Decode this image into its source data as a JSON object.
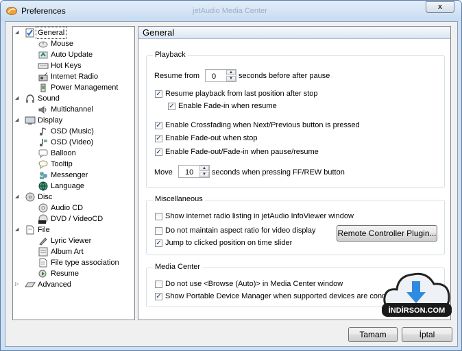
{
  "window": {
    "title": "Preferences",
    "ghost_title": "jetAudio Media Center",
    "close_label": "x"
  },
  "tree": {
    "items": [
      {
        "label": "General",
        "icon": "checklist-icon",
        "level": 0,
        "expander": "expanded",
        "selected": true
      },
      {
        "label": "Mouse",
        "icon": "mouse-icon",
        "level": 1
      },
      {
        "label": "Auto Update",
        "icon": "update-icon",
        "level": 1
      },
      {
        "label": "Hot Keys",
        "icon": "keyboard-icon",
        "level": 1
      },
      {
        "label": "Internet Radio",
        "icon": "radio-icon",
        "level": 1
      },
      {
        "label": "Power Management",
        "icon": "power-icon",
        "level": 1
      },
      {
        "label": "Sound",
        "icon": "headphones-icon",
        "level": 0,
        "expander": "expanded"
      },
      {
        "label": "Multichannel",
        "icon": "speaker-icon",
        "level": 1
      },
      {
        "label": "Display",
        "icon": "monitor-icon",
        "level": 0,
        "expander": "expanded"
      },
      {
        "label": "OSD (Music)",
        "icon": "music-note-icon",
        "level": 1
      },
      {
        "label": "OSD (Video)",
        "icon": "video-note-icon",
        "level": 1
      },
      {
        "label": "Balloon",
        "icon": "balloon-icon",
        "level": 1
      },
      {
        "label": "Tooltip",
        "icon": "tooltip-icon",
        "level": 1
      },
      {
        "label": "Messenger",
        "icon": "messenger-icon",
        "level": 1
      },
      {
        "label": "Language",
        "icon": "globe-icon",
        "level": 1
      },
      {
        "label": "Disc",
        "icon": "disc-icon",
        "level": 0,
        "expander": "expanded"
      },
      {
        "label": "Audio CD",
        "icon": "cd-icon",
        "level": 1
      },
      {
        "label": "DVD / VideoCD",
        "icon": "dvd-icon",
        "level": 1
      },
      {
        "label": "File",
        "icon": "file-icon",
        "level": 0,
        "expander": "expanded"
      },
      {
        "label": "Lyric Viewer",
        "icon": "pen-icon",
        "level": 1
      },
      {
        "label": "Album Art",
        "icon": "album-art-icon",
        "level": 1
      },
      {
        "label": "File type association",
        "icon": "document-icon",
        "level": 1
      },
      {
        "label": "Resume",
        "icon": "resume-icon",
        "level": 1
      },
      {
        "label": "Advanced",
        "icon": "advanced-icon",
        "level": 0,
        "expander": "collapsed"
      }
    ]
  },
  "panel": {
    "header": "General",
    "playback": {
      "title": "Playback",
      "resume_from_label": "Resume from",
      "resume_from_value": "0",
      "resume_from_suffix": "seconds before after pause",
      "resume_position": {
        "label": "Resume playback from last position after stop",
        "checked": true
      },
      "fade_in_resume": {
        "label": "Enable Fade-in when resume",
        "checked": true
      },
      "crossfading": {
        "label": "Enable Crossfading when Next/Previous button is pressed",
        "checked": true
      },
      "fade_out_stop": {
        "label": "Enable Fade-out when stop",
        "checked": true
      },
      "fade_pause": {
        "label": "Enable Fade-out/Fade-in when pause/resume",
        "checked": true
      },
      "move_label": "Move",
      "move_value": "10",
      "move_suffix": "seconds when pressing FF/REW button"
    },
    "misc": {
      "title": "Miscellaneous",
      "radio_listing": {
        "label": "Show internet radio listing in jetAudio InfoViewer window",
        "checked": false
      },
      "aspect_ratio": {
        "label": "Do not maintain aspect ratio for video display",
        "checked": false
      },
      "jump_slider": {
        "label": "Jump to clicked position on time slider",
        "checked": true
      },
      "remote_button": "Remote Controller Plugin..."
    },
    "media_center": {
      "title": "Media Center",
      "browse_auto": {
        "label": "Do not use <Browse (Auto)> in Media Center window",
        "checked": false
      },
      "portable_device": {
        "label": "Show Portable Device Manager when supported devices are conne",
        "checked": true
      }
    }
  },
  "footer": {
    "ok_label": "Tamam",
    "cancel_label": "İptal"
  },
  "watermark": {
    "text": "İNDİRSON.COM"
  },
  "colors": {
    "window_frame": "#cfe0f2",
    "check_color": "#1c3a70",
    "watermark_arrow": "#2e8be0"
  }
}
